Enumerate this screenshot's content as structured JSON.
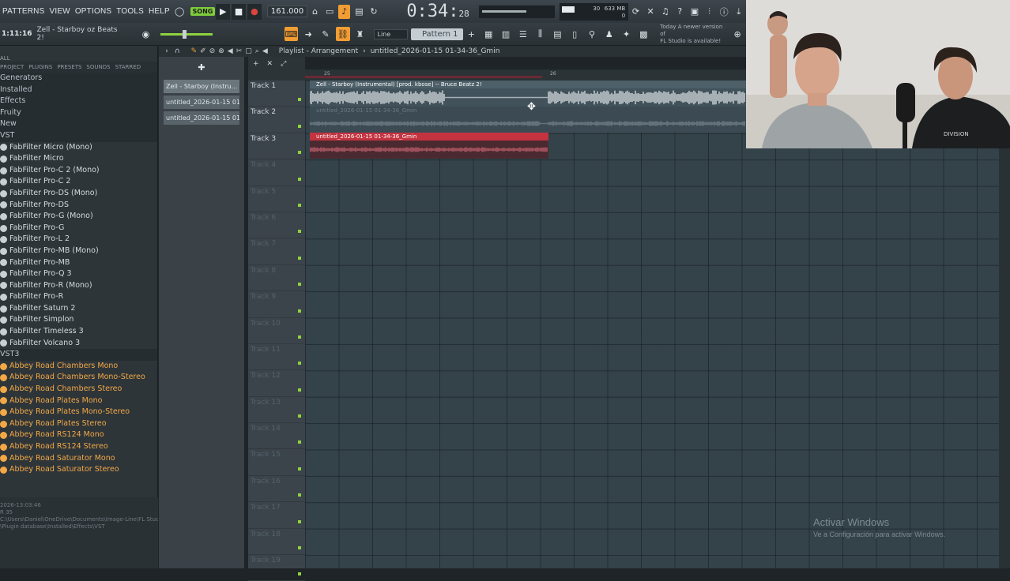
{
  "menu": [
    "PATTERNS",
    "VIEW",
    "OPTIONS",
    "TOOLS",
    "HELP"
  ],
  "transport": {
    "pattern_badge": "SONG",
    "tempo": "161.000",
    "time_main": "0:34:",
    "time_sub": "28",
    "cpu_value": "30",
    "memory": "633 MB",
    "voices": "0"
  },
  "toolbar2": {
    "time_small": "1:11:16",
    "song_name": "Zell - Starboy oz Beats 2!",
    "snap": "Line",
    "pattern": "Pattern 1",
    "news": [
      "Today  A newer version of",
      "FL Studio is available!"
    ]
  },
  "browser": {
    "head": "ALL",
    "tabs": [
      "PROJECT",
      "PLUGINS",
      "PRESETS",
      "SOUNDS",
      "STARRED"
    ],
    "items": [
      {
        "label": "Generators",
        "type": "cat"
      },
      {
        "label": "Installed",
        "type": "cat"
      },
      {
        "label": "Effects",
        "type": "cat"
      },
      {
        "label": "Fruity",
        "type": "cat"
      },
      {
        "label": "New",
        "type": "cat"
      },
      {
        "label": "VST",
        "type": "cat"
      },
      {
        "label": "FabFilter Micro (Mono)",
        "type": "plugin"
      },
      {
        "label": "FabFilter Micro",
        "type": "plugin"
      },
      {
        "label": "FabFilter Pro-C 2 (Mono)",
        "type": "plugin"
      },
      {
        "label": "FabFilter Pro-C 2",
        "type": "plugin"
      },
      {
        "label": "FabFilter Pro-DS (Mono)",
        "type": "plugin"
      },
      {
        "label": "FabFilter Pro-DS",
        "type": "plugin"
      },
      {
        "label": "FabFilter Pro-G (Mono)",
        "type": "plugin"
      },
      {
        "label": "FabFilter Pro-G",
        "type": "plugin"
      },
      {
        "label": "FabFilter Pro-L 2",
        "type": "plugin"
      },
      {
        "label": "FabFilter Pro-MB (Mono)",
        "type": "plugin"
      },
      {
        "label": "FabFilter Pro-MB",
        "type": "plugin"
      },
      {
        "label": "FabFilter Pro-Q 3",
        "type": "plugin"
      },
      {
        "label": "FabFilter Pro-R (Mono)",
        "type": "plugin"
      },
      {
        "label": "FabFilter Pro-R",
        "type": "plugin"
      },
      {
        "label": "FabFilter Saturn 2",
        "type": "plugin"
      },
      {
        "label": "FabFilter Simplon",
        "type": "plugin"
      },
      {
        "label": "FabFilter Timeless 3",
        "type": "plugin"
      },
      {
        "label": "FabFilter Volcano 3",
        "type": "plugin"
      },
      {
        "label": "VST3",
        "type": "cat"
      },
      {
        "label": "Abbey Road Chambers Mono",
        "type": "orange"
      },
      {
        "label": "Abbey Road Chambers Mono-Stereo",
        "type": "orange"
      },
      {
        "label": "Abbey Road Chambers Stereo",
        "type": "orange"
      },
      {
        "label": "Abbey Road Plates Mono",
        "type": "orange"
      },
      {
        "label": "Abbey Road Plates Mono-Stereo",
        "type": "orange"
      },
      {
        "label": "Abbey Road Plates Stereo",
        "type": "orange"
      },
      {
        "label": "Abbey Road RS124 Mono",
        "type": "orange"
      },
      {
        "label": "Abbey Road RS124 Stereo",
        "type": "orange"
      },
      {
        "label": "Abbey Road Saturator Mono",
        "type": "orange"
      },
      {
        "label": "Abbey Road Saturator Stereo",
        "type": "orange"
      }
    ],
    "footer": [
      "2026-13:03:46",
      "R  35",
      "C:\\Users\\Daniel\\OneDrive\\Documents\\Image-Line\\FL Studio",
      "\\Plugin database\\Installed\\Effects\\VST"
    ]
  },
  "channels": [
    "Zell - Starboy (Instru...",
    "untitled_2026-01-15 01-...",
    "untitled_2026-01-15 01-..."
  ],
  "playlist": {
    "title": "Playlist - Arrangement",
    "project": "untitled_2026-01-15 01-34-36_Gmin",
    "ruler": [
      "25",
      "26"
    ],
    "tracks": [
      "Track 1",
      "Track 2",
      "Track 3",
      "Track 4",
      "Track 5",
      "Track 6",
      "Track 7",
      "Track 8",
      "Track 9",
      "Track 10",
      "Track 11",
      "Track 12",
      "Track 13",
      "Track 14",
      "Track 15",
      "Track 16",
      "Track 17",
      "Track 18",
      "Track 19"
    ],
    "clips": [
      {
        "label": "Zell - Starboy (Instrumental) [prod. kbose] -- Bruce Beatz 2!"
      },
      {
        "label": "untitled_2026-01-15 01-34-36_Gmin"
      },
      {
        "label": "untitled_2026-01-15 01-34-36_Gmin"
      }
    ]
  },
  "overlay": {
    "activate_title": "Activar Windows",
    "activate_sub": "Ve a Configuración para activar Windows."
  },
  "colors": {
    "accent": "#f29d34",
    "clip_red": "#c33340",
    "led_green": "#8fd23f"
  }
}
